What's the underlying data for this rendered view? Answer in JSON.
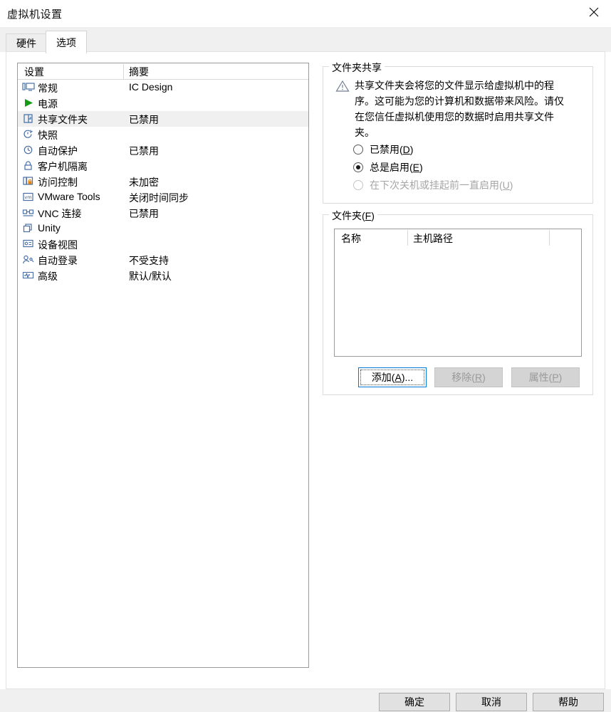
{
  "window": {
    "title": "虚拟机设置",
    "close_icon": "close-icon"
  },
  "tabs": [
    {
      "label": "硬件",
      "active": false
    },
    {
      "label": "选项",
      "active": true
    }
  ],
  "settings_list": {
    "headers": {
      "name": "设置",
      "summary": "摘要"
    },
    "rows": [
      {
        "icon": "monitor-icon",
        "label": "常规",
        "summary": "IC Design",
        "selected": false
      },
      {
        "icon": "power-play-icon",
        "label": "电源",
        "summary": "",
        "selected": false
      },
      {
        "icon": "shared-folder-icon",
        "label": "共享文件夹",
        "summary": "已禁用",
        "selected": true
      },
      {
        "icon": "snapshot-clock-icon",
        "label": "快照",
        "summary": "",
        "selected": false
      },
      {
        "icon": "autoprotect-clock-icon",
        "label": "自动保护",
        "summary": "已禁用",
        "selected": false
      },
      {
        "icon": "lock-icon",
        "label": "客户机隔离",
        "summary": "",
        "selected": false
      },
      {
        "icon": "access-control-icon",
        "label": "访问控制",
        "summary": "未加密",
        "selected": false
      },
      {
        "icon": "vmware-tools-icon",
        "label": "VMware Tools",
        "summary": "关闭时间同步",
        "selected": false
      },
      {
        "icon": "vnc-network-icon",
        "label": "VNC 连接",
        "summary": "已禁用",
        "selected": false
      },
      {
        "icon": "unity-windows-icon",
        "label": "Unity",
        "summary": "",
        "selected": false
      },
      {
        "icon": "device-view-icon",
        "label": "设备视图",
        "summary": "",
        "selected": false
      },
      {
        "icon": "auto-login-user-icon",
        "label": "自动登录",
        "summary": "不受支持",
        "selected": false
      },
      {
        "icon": "advanced-wave-icon",
        "label": "高级",
        "summary": "默认/默认",
        "selected": false
      }
    ]
  },
  "folder_sharing": {
    "legend": "文件夹共享",
    "warning_icon": "warning-triangle-icon",
    "warning_text": "共享文件夹会将您的文件显示给虚拟机中的程序。这可能为您的计算机和数据带来风险。请仅在您信任虚拟机使用您的数据时启用共享文件夹。",
    "options": [
      {
        "label_pre": "已禁用(",
        "mnemonic": "D",
        "label_post": ")",
        "checked": false,
        "disabled": false
      },
      {
        "label_pre": "总是启用(",
        "mnemonic": "E",
        "label_post": ")",
        "checked": true,
        "disabled": false
      },
      {
        "label_pre": "在下次关机或挂起前一直启用(",
        "mnemonic": "U",
        "label_post": ")",
        "checked": false,
        "disabled": true
      }
    ]
  },
  "folders_group": {
    "legend_pre": "文件夹(",
    "legend_mn": "F",
    "legend_post": ")",
    "columns": [
      "名称",
      "主机路径",
      ""
    ],
    "rows": [],
    "buttons": {
      "add": {
        "label_pre": "添加(",
        "mnemonic": "A",
        "label_post": ")...",
        "disabled": false,
        "focused": true
      },
      "remove": {
        "label_pre": "移除(",
        "mnemonic": "R",
        "label_post": ")",
        "disabled": true,
        "focused": false
      },
      "props": {
        "label_pre": "属性(",
        "mnemonic": "P",
        "label_post": ")",
        "disabled": true,
        "focused": false
      }
    }
  },
  "footer": {
    "ok": "确定",
    "cancel": "取消",
    "help": "帮助"
  },
  "colors": {
    "focus_blue": "#0078d7",
    "selection_gray": "#f0f0f0",
    "power_green": "#169b16",
    "padlock_orange": "#e8820c",
    "vm_blue": "#1f5fa9"
  }
}
